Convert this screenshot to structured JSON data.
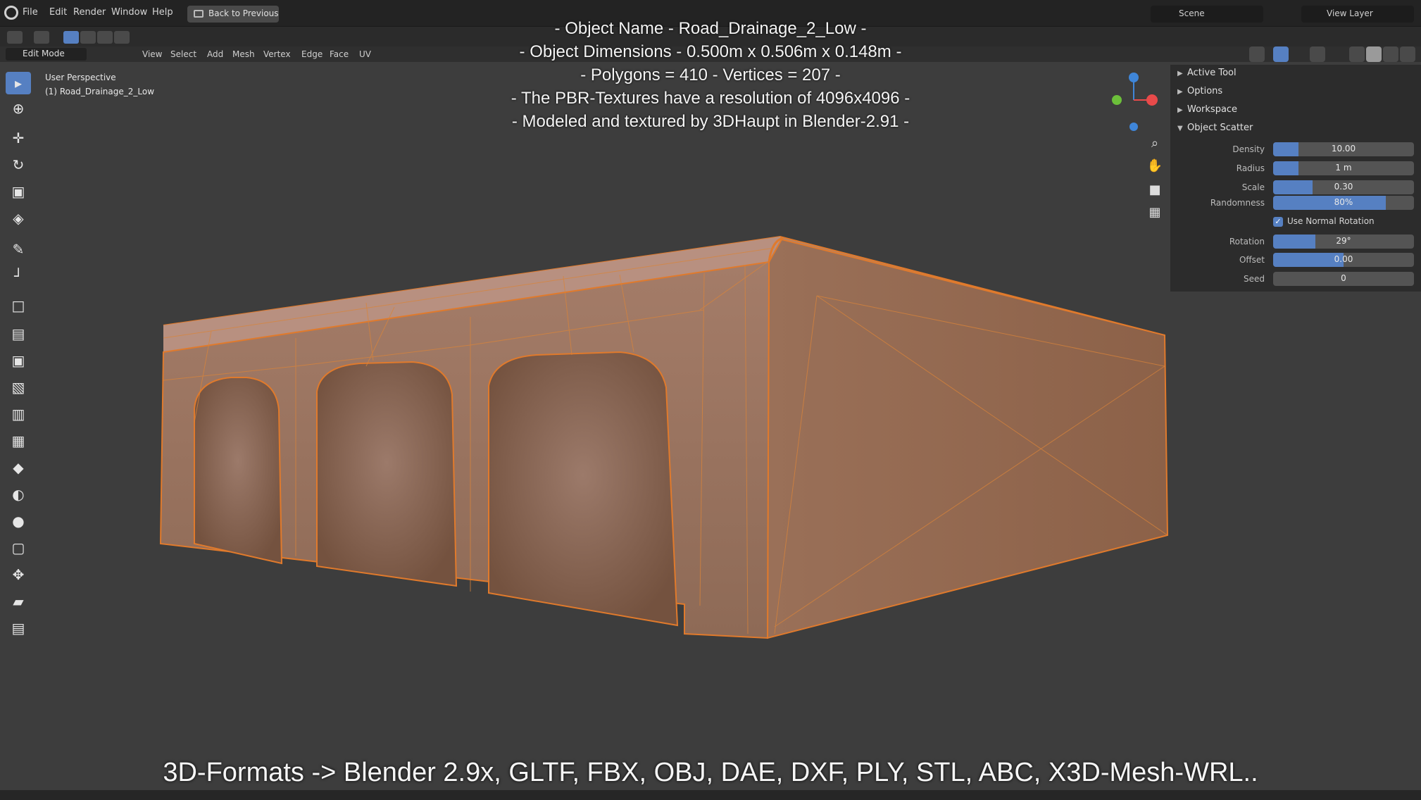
{
  "menubar": {
    "items": [
      "File",
      "Edit",
      "Render",
      "Window",
      "Help"
    ],
    "back_button": "Back to Previous",
    "scene": "Scene",
    "view_layer": "View Layer"
  },
  "header": {
    "mode": "Edit Mode",
    "menus": [
      "View",
      "Select",
      "Add",
      "Mesh",
      "Vertex",
      "Edge",
      "Face",
      "UV"
    ]
  },
  "viewport": {
    "view_name": "User Perspective",
    "object_label": "(1) Road_Drainage_2_Low"
  },
  "overlay_text": {
    "line1": "- Object Name - Road_Drainage_2_Low  -",
    "line2": "- Object Dimensions -  0.500m x 0.506m x 0.148m -",
    "line3": "- Polygons = 410  -  Vertices = 207 -",
    "line4": "- The PBR-Textures have a resolution of 4096x4096 -",
    "line5": "- Modeled and textured by 3DHaupt in Blender-2.91 -",
    "formats": "3D-Formats -> Blender 2.9x, GLTF, FBX, OBJ, DAE, DXF, PLY, STL, ABC, X3D-Mesh-WRL.."
  },
  "sidebar": {
    "panels": [
      "Active Tool",
      "Options",
      "Workspace",
      "Object Scatter"
    ],
    "fields": [
      {
        "label": "Density",
        "value": "10.00",
        "fill": 0.18
      },
      {
        "label": "Radius",
        "value": "1 m",
        "fill": 0.18
      },
      {
        "label": "Scale",
        "value": "0.30",
        "fill": 0.28
      },
      {
        "label": "Randomness",
        "value": "80%",
        "fill": 0.8
      },
      {
        "label": "Rotation",
        "value": "29°",
        "fill": 0.3
      },
      {
        "label": "Offset",
        "value": "0.00",
        "fill": 0.5
      },
      {
        "label": "Seed",
        "value": "0",
        "fill": 0
      }
    ],
    "checkbox_label": "Use Normal Rotation",
    "checkbox_checked": true
  },
  "gizmo": {
    "axis_colors": {
      "x": "#e84a4a",
      "y": "#6cbf3a",
      "z": "#3f86d9"
    }
  },
  "colors": {
    "accent": "#5680c2",
    "mesh_wire": "#e07a2c",
    "viewport_bg": "#3d3d3d"
  }
}
